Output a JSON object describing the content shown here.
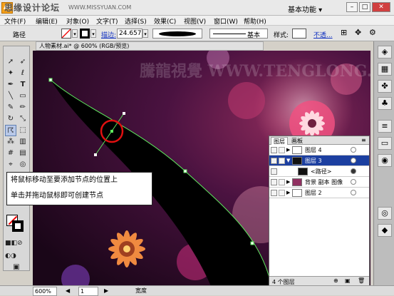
{
  "titlebar": {
    "logo": "Ai",
    "watermark": "思缘设计论坛",
    "watermark_en": "WWW.MISSYUAN.COM",
    "workspace": "基本功能 ▾",
    "min": "–",
    "max": "□",
    "close": "✕"
  },
  "menu": [
    "文件(F)",
    "编辑(E)",
    "对象(O)",
    "文字(T)",
    "选择(S)",
    "效果(C)",
    "视图(V)",
    "窗口(W)",
    "帮助(H)"
  ],
  "control": {
    "label": "路径",
    "stroke_label": "描边:",
    "stroke_value": "24.657",
    "profile_label": "基本",
    "style_label": "样式:",
    "opacity_label": "不透..."
  },
  "document": {
    "tab": "人物素材.ai* @ 600% (RGB/预览)",
    "watermark": "騰龍視覺 WWW.TENGLONG.NET"
  },
  "caption": {
    "line1": "将鼠标移动至要添加节点的位置上",
    "line2": "单击并拖动鼠标即可创建节点"
  },
  "layers": {
    "tabs": [
      "图层",
      "画板"
    ],
    "rows": [
      {
        "name": "图层 4",
        "selected": false
      },
      {
        "name": "图层 3",
        "selected": true
      },
      {
        "name": "<路径>",
        "selected": false
      },
      {
        "name": "背景 副本 图像",
        "selected": false
      },
      {
        "name": "图层 2",
        "selected": false
      }
    ],
    "footer": "4 个图层"
  },
  "status": {
    "zoom": "600%",
    "page": "1",
    "mode": "宽度"
  },
  "icons": {
    "tools": [
      "selection-tool",
      "direct-selection-tool",
      "magic-wand",
      "lasso",
      "pen-tool",
      "type-tool",
      "line-tool",
      "rectangle-tool",
      "paintbrush",
      "pencil",
      "rotate",
      "scale",
      "warp",
      "free-transform",
      "symbol-sprayer",
      "graph",
      "mesh",
      "gradient",
      "eyedropper",
      "blend",
      "slice",
      "scissors",
      "hand",
      "zoom"
    ]
  },
  "colors": {
    "canvas_bg": "#2a0a2a",
    "path_green": "#5fe85f",
    "marker_red": "#e01010",
    "selected_layer": "#1c3fa0"
  }
}
